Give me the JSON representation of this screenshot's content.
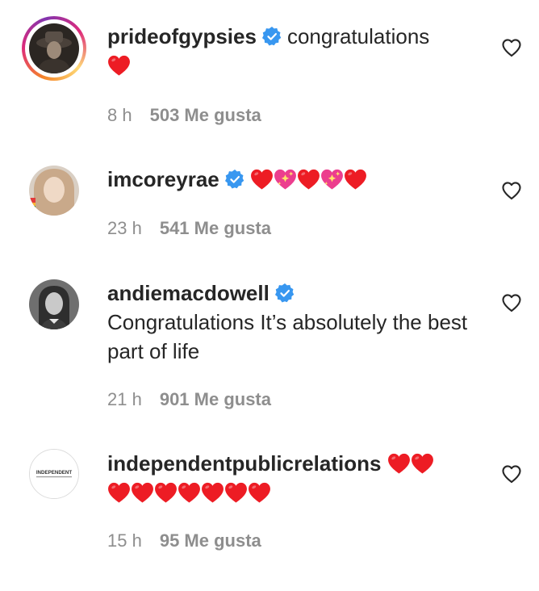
{
  "comments": [
    {
      "username": "prideofgypsies",
      "verified": true,
      "text": "congratulations",
      "hearts": 1,
      "time": "8 h",
      "likes": "503 Me gusta"
    },
    {
      "username": "imcoreyrae",
      "verified": true,
      "text": "",
      "hearts_sequence": [
        "red",
        "sparkle",
        "red",
        "sparkle",
        "red"
      ],
      "time": "23 h",
      "likes": "541 Me gusta"
    },
    {
      "username": "andiemacdowell",
      "verified": true,
      "text": "Congratulations It’s absolutely the best part of life",
      "time": "21 h",
      "likes": "901 Me gusta"
    },
    {
      "username": "independentpublicrelations",
      "verified": false,
      "hearts_line1": 2,
      "hearts_line2": 7,
      "avatar_text": "INDEPENDENT",
      "time": "15 h",
      "likes": "95 Me gusta"
    }
  ],
  "icons": {
    "verified": "verified-badge-icon",
    "like": "heart-outline-icon",
    "heart_emoji": "red-heart-emoji",
    "sparkle_heart_emoji": "sparkling-heart-emoji"
  },
  "colors": {
    "text": "#262626",
    "meta": "#8e8e8e",
    "verified_blue": "#3897f0",
    "heart_red": "#ed1c24",
    "sparkle_pink": "#ec3e8e"
  }
}
